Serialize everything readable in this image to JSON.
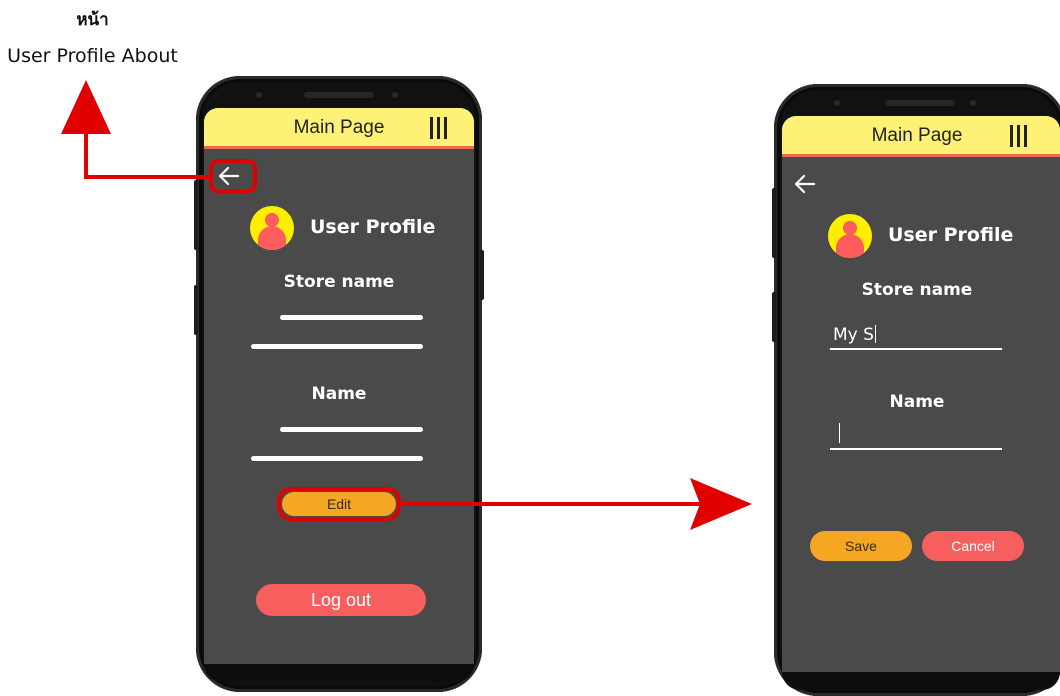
{
  "captions": {
    "line1": "หน้า",
    "line2": "User Profile About"
  },
  "left_screen": {
    "appbar": {
      "title": "Main Page",
      "menu_icon": "menu-icon"
    },
    "back_icon": "arrow-left-icon",
    "profile_title": "User Profile",
    "store_label": "Store name",
    "name_label": "Name",
    "edit_label": "Edit",
    "logout_label": "Log out"
  },
  "right_screen": {
    "appbar": {
      "title": "Main Page",
      "menu_icon": "menu-icon"
    },
    "back_icon": "arrow-left-icon",
    "profile_title": "User Profile",
    "store_label": "Store name",
    "store_value": "My S",
    "name_label": "Name",
    "name_value": "",
    "save_label": "Save",
    "cancel_label": "Cancel"
  },
  "colors": {
    "appbar": "#fdf275",
    "appbar_border": "#f16a48",
    "screen_bg": "#4a4a4a",
    "accent_orange": "#f5a623",
    "accent_red": "#f75f5f",
    "annotation_red": "#e00000"
  }
}
